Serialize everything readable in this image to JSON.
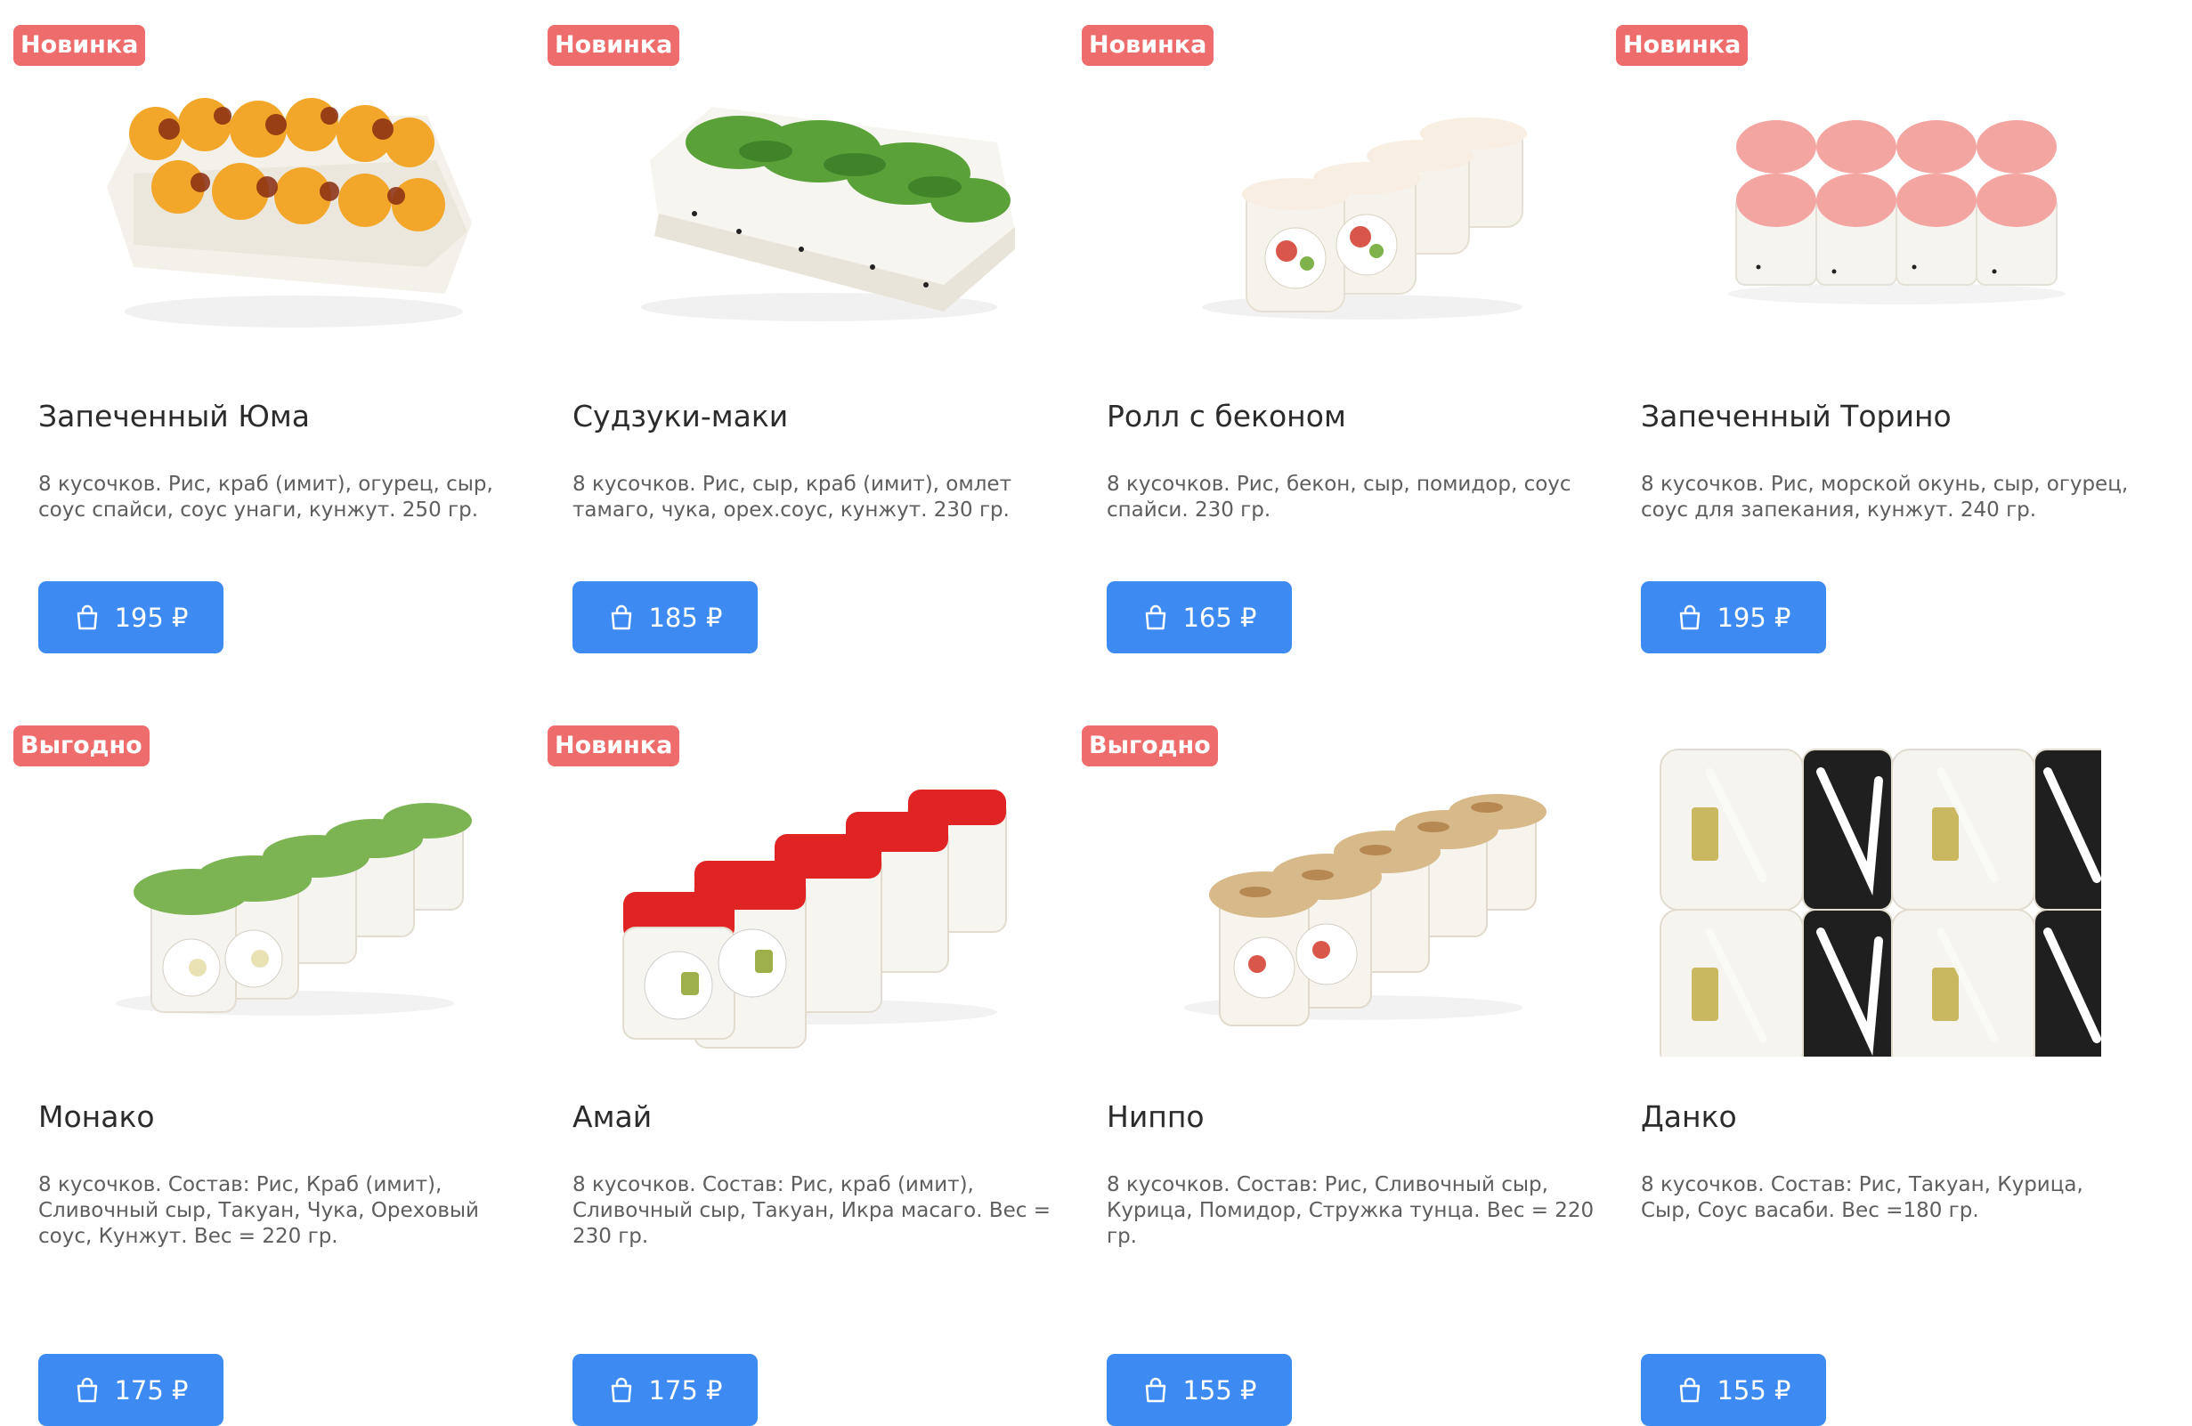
{
  "products": [
    {
      "badge": "Новинка",
      "name": "Запеченный Юма",
      "description": "8 кусочков. Рис, краб (имит), огурец, сыр, соус спайси, соус унаги, кунжут. 250 гр.",
      "price": "195 ₽",
      "image": "baked-roll-orange-topping"
    },
    {
      "badge": "Новинка",
      "name": "Судзуки-маки",
      "description": "8 кусочков. Рис, сыр, краб (имит), омлет тамаго, чука, орех.соус, кунжут. 230 гр.",
      "price": "185 ₽",
      "image": "roll-chuka-topping"
    },
    {
      "badge": "Новинка",
      "name": "Ролл с беконом",
      "description": "8 кусочков. Рис, бекон, сыр, помидор, соус спайси. 230 гр.",
      "price": "165 ₽",
      "image": "roll-bacon"
    },
    {
      "badge": "Новинка",
      "name": "Запеченный Торино",
      "description": "8 кусочков. Рис, морской окунь, сыр, огурец, соус для запекания, кунжут. 240 гр.",
      "price": "195 ₽",
      "image": "baked-roll-pink-topping"
    },
    {
      "badge": "Выгодно",
      "name": "Монако",
      "description": "8 кусочков. Состав: Рис, Краб (имит), Сливочный сыр, Такуан, Чука, Ореховый соус, Кунжут. Вес = 220 гр.",
      "price": "175 ₽",
      "image": "roll-chuka-side"
    },
    {
      "badge": "Новинка",
      "name": "Амай",
      "description": "8 кусочков. Состав: Рис, краб (имит), Сливочный сыр, Такуан, Икра масаго. Вес = 230 гр.",
      "price": "175 ₽",
      "image": "roll-red-masago"
    },
    {
      "badge": "Выгодно",
      "name": "Ниппо",
      "description": "8 кусочков. Состав: Рис, Сливочный сыр, Курица, Помидор, Стружка тунца. Вес = 220 гр.",
      "price": "155 ₽",
      "image": "roll-tuna-flakes"
    },
    {
      "badge": "",
      "name": "Данко",
      "description": "8 кусочков. Состав: Рис, Такуан, Курица, Сыр, Соус васаби. Вес =180 гр.",
      "price": "155 ₽",
      "image": "roll-nori-wasabi-sauce"
    }
  ],
  "colors": {
    "accent": "#3d8bf2",
    "badge": "#ef6c6c",
    "text": "#2b2b2b",
    "muted": "#5e5e5e"
  },
  "icons": {
    "cart": "shopping-bag-icon"
  }
}
